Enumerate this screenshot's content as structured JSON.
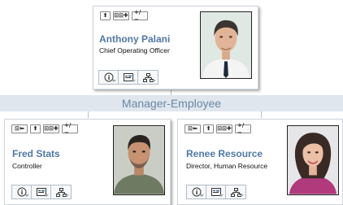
{
  "manager": {
    "name": "Anthony Palani",
    "title": "Chief Operating Officer",
    "toolbar": [
      "⬆",
      "⊡⊡✚",
      "+/−"
    ],
    "photo_icon": "person-photo-icon"
  },
  "section_label": "Manager-Employee",
  "employees": [
    {
      "name": "Fred Stats",
      "title": "Controller",
      "toolbar": [
        "⊡⬅",
        "⬆",
        "⊡⊡✚",
        "+/−"
      ],
      "photo_icon": "person-photo-icon"
    },
    {
      "name": "Renee Resource",
      "title": "Director, Human Resource",
      "toolbar": [
        "⊡⬅",
        "⬆",
        "⊡⊡✚",
        "+/−"
      ],
      "photo_icon": "person-photo-icon"
    }
  ],
  "action_icons": [
    "info-icon",
    "contact-card-icon",
    "org-chart-icon"
  ],
  "colors": {
    "name": "#4f78a6",
    "band": "#dfe6ee",
    "band_text": "#6c86a3"
  }
}
